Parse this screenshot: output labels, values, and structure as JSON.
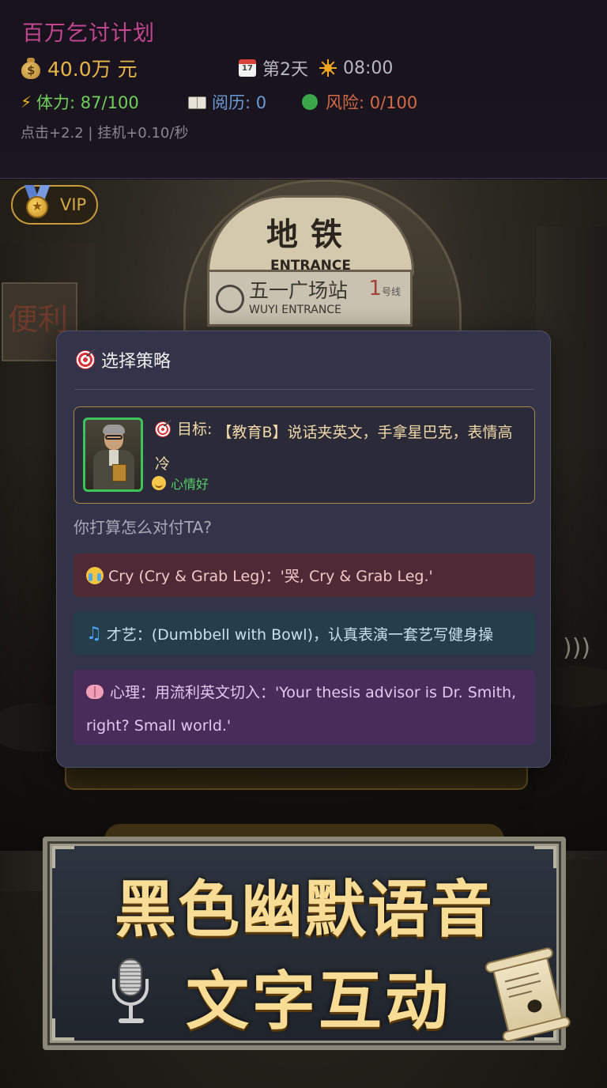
{
  "app": {
    "title": "百万乞讨计划"
  },
  "status": {
    "money": "40.0万 元",
    "day": "第2天",
    "time": "08:00",
    "stamina": "体力: 87/100",
    "experience": "阅历: 0",
    "risk": "风险: 0/100",
    "rates": "点击+2.2 | 挂机+0.10/秒",
    "icons": {
      "money": "money-bag-icon",
      "day": "calendar-icon",
      "time": "sun-icon",
      "stamina": "lightning-icon",
      "experience": "book-icon",
      "risk": "green-circle-icon"
    }
  },
  "scene": {
    "metro_title": "地铁",
    "metro_entrance": "ENTRANCE",
    "station_cn": "五一广场站",
    "station_en": "WUYI ENTRANCE",
    "line_num": "1",
    "line_cn": "号线",
    "line_en": "Line 1",
    "left_sign": "便利"
  },
  "vip": {
    "label": "VIP"
  },
  "modal": {
    "title": "选择策略",
    "target_label": "目标:",
    "target_desc": "【教育B】说话夹英文，手拿星巴克，表情高冷",
    "mood": "心情好",
    "question": "你打算怎么对付TA?",
    "options": [
      {
        "icon": "crying-face-icon",
        "text": "Cry (Cry & Grab Leg)：'哭, Cry & Grab Leg.'"
      },
      {
        "icon": "music-note-icon",
        "text": "才艺：(Dumbbell with Bowl)，认真表演一套艺写健身操"
      },
      {
        "icon": "brain-icon",
        "text": "心理：用流利英文切入：'Your thesis advisor is Dr. Smith, right? Small world.'"
      }
    ]
  },
  "banner": {
    "line1": "黑色幽默语音",
    "line2": "文字互动"
  },
  "colors": {
    "title": "#c2478f",
    "money": "#e6b54a",
    "stamina": "#6fd05a",
    "experience": "#6d9bd4",
    "risk": "#d56a47",
    "modal_bg": "#33344a",
    "option_cry": "#4f2a36",
    "option_talent": "#243e4a",
    "option_psych": "#482c5a"
  }
}
